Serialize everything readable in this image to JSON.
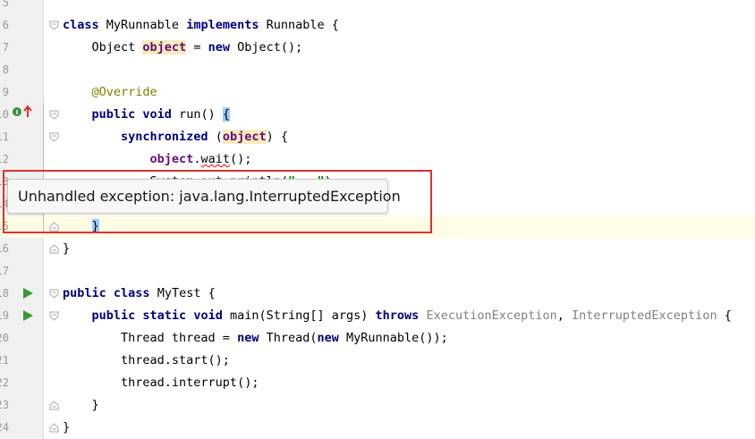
{
  "editor": {
    "lines": [
      {
        "num": "5",
        "segments": []
      },
      {
        "num": "6",
        "segments": [
          {
            "t": "class ",
            "c": "kw"
          },
          {
            "t": "MyRunnable ",
            "c": ""
          },
          {
            "t": "implements ",
            "c": "kw"
          },
          {
            "t": "Runnable {",
            "c": ""
          }
        ]
      },
      {
        "num": "7",
        "segments": [
          {
            "t": "    Object ",
            "c": ""
          },
          {
            "t": "object",
            "c": "fld mark"
          },
          {
            "t": " = ",
            "c": ""
          },
          {
            "t": "new ",
            "c": "kw"
          },
          {
            "t": "Object();",
            "c": ""
          }
        ]
      },
      {
        "num": "8",
        "segments": []
      },
      {
        "num": "9",
        "segments": [
          {
            "t": "    ",
            "c": ""
          },
          {
            "t": "@Override",
            "c": "an"
          }
        ]
      },
      {
        "num": "10",
        "segments": [
          {
            "t": "    ",
            "c": ""
          },
          {
            "t": "public ",
            "c": "kw"
          },
          {
            "t": "void ",
            "c": "kw"
          },
          {
            "t": "run() ",
            "c": ""
          },
          {
            "t": "{",
            "c": "brace"
          }
        ]
      },
      {
        "num": "11",
        "segments": [
          {
            "t": "        ",
            "c": ""
          },
          {
            "t": "synchronized ",
            "c": "kw"
          },
          {
            "t": "(",
            "c": ""
          },
          {
            "t": "object",
            "c": "fld mark"
          },
          {
            "t": ") {",
            "c": ""
          }
        ]
      },
      {
        "num": "12",
        "segments": [
          {
            "t": "            ",
            "c": ""
          },
          {
            "t": "object",
            "c": "fld"
          },
          {
            "t": ".",
            "c": ""
          },
          {
            "t": "wait",
            "c": "squig"
          },
          {
            "t": "();",
            "c": ""
          }
        ]
      },
      {
        "num": "13",
        "segments": [
          {
            "t": "            System.out.println(",
            "c": ""
          },
          {
            "t": "\"...\"",
            "c": "str"
          },
          {
            "t": ");",
            "c": ""
          }
        ]
      },
      {
        "num": "14",
        "segments": [
          {
            "t": "        }",
            "c": ""
          }
        ]
      },
      {
        "num": "15",
        "segments": [
          {
            "t": "    ",
            "c": ""
          },
          {
            "t": "}",
            "c": "brace"
          }
        ]
      },
      {
        "num": "16",
        "segments": [
          {
            "t": "}",
            "c": ""
          }
        ]
      },
      {
        "num": "17",
        "segments": []
      },
      {
        "num": "18",
        "segments": [
          {
            "t": "public ",
            "c": "kw"
          },
          {
            "t": "class ",
            "c": "kw"
          },
          {
            "t": "MyTest {",
            "c": ""
          }
        ]
      },
      {
        "num": "19",
        "segments": [
          {
            "t": "    ",
            "c": ""
          },
          {
            "t": "public ",
            "c": "kw"
          },
          {
            "t": "static ",
            "c": "kw"
          },
          {
            "t": "void ",
            "c": "kw"
          },
          {
            "t": "main(String[] args) ",
            "c": ""
          },
          {
            "t": "throws ",
            "c": "kw"
          },
          {
            "t": "ExecutionException",
            "c": "gray"
          },
          {
            "t": ", ",
            "c": ""
          },
          {
            "t": "InterruptedException",
            "c": "gray"
          },
          {
            "t": " {",
            "c": ""
          }
        ]
      },
      {
        "num": "20",
        "segments": [
          {
            "t": "        Thread thread = ",
            "c": ""
          },
          {
            "t": "new ",
            "c": "kw"
          },
          {
            "t": "Thread(",
            "c": ""
          },
          {
            "t": "new ",
            "c": "kw"
          },
          {
            "t": "MyRunnable());",
            "c": ""
          }
        ]
      },
      {
        "num": "21",
        "segments": [
          {
            "t": "        thread.start();",
            "c": ""
          }
        ]
      },
      {
        "num": "22",
        "segments": [
          {
            "t": "        thread.interrupt();",
            "c": ""
          }
        ]
      },
      {
        "num": "23",
        "segments": [
          {
            "t": "    }",
            "c": ""
          }
        ]
      },
      {
        "num": "24",
        "segments": [
          {
            "t": "}",
            "c": ""
          }
        ]
      }
    ]
  },
  "tooltip": {
    "text": "Unhandled exception: java.lang.InterruptedException"
  },
  "icons": {
    "run": "run-arrow-icon",
    "override": "override-method-icon",
    "fold": "fold-marker-icon"
  },
  "colors": {
    "keyword": "#000080",
    "annotation": "#808000",
    "field": "#660e7a",
    "highlight": "#fefce4",
    "error_box": "#e03030"
  }
}
